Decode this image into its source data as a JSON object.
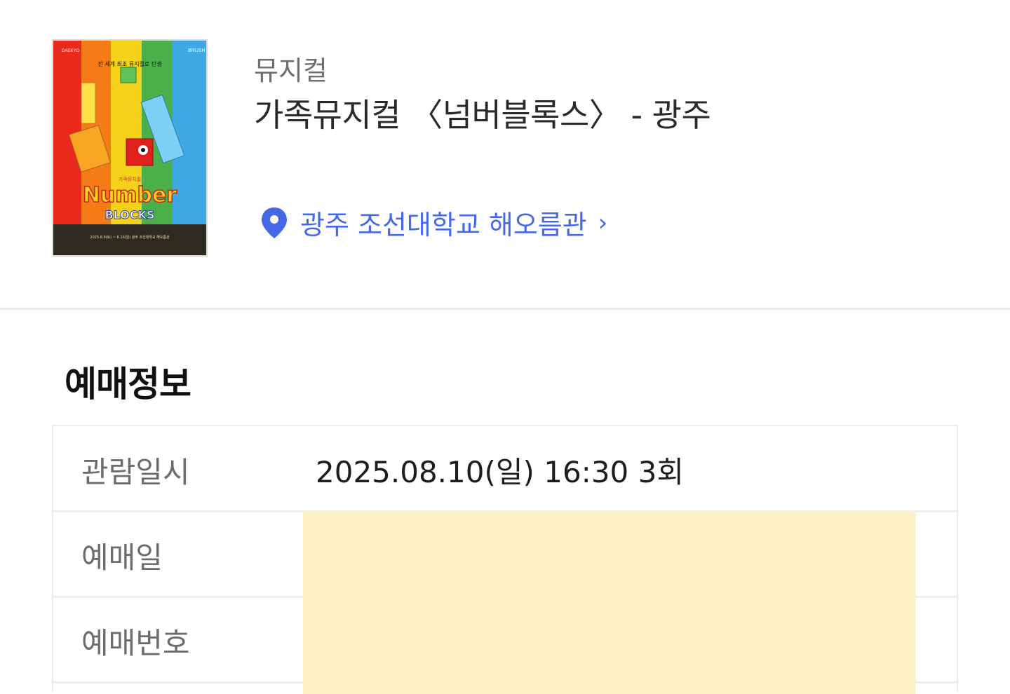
{
  "event": {
    "category": "뮤지컬",
    "title": "가족뮤지컬 〈넘버블록스〉 - 광주",
    "venue": "광주 조선대학교 해오름관",
    "venue_chevron": "›",
    "poster": {
      "brand_left": "DAEKYO",
      "brand_right": "BRUSH",
      "tagline": "전 세계 최초 뮤지컬로 탄생",
      "subtitle": "가족뮤지컬",
      "logo_line1": "Number",
      "logo_line2": "BLOCKS",
      "date_line": "2025.8.9(토) ~ 8.10(일) 광주 조선대학교 해오름관"
    }
  },
  "booking": {
    "section_title": "예매정보",
    "rows": [
      {
        "label": "관람일시",
        "value": "2025.08.10(일) 16:30 3회"
      },
      {
        "label": "예매일",
        "value": ""
      },
      {
        "label": "예매번호",
        "value": ""
      }
    ]
  },
  "colors": {
    "link": "#4569e6",
    "redaction": "#fdf2c3"
  }
}
